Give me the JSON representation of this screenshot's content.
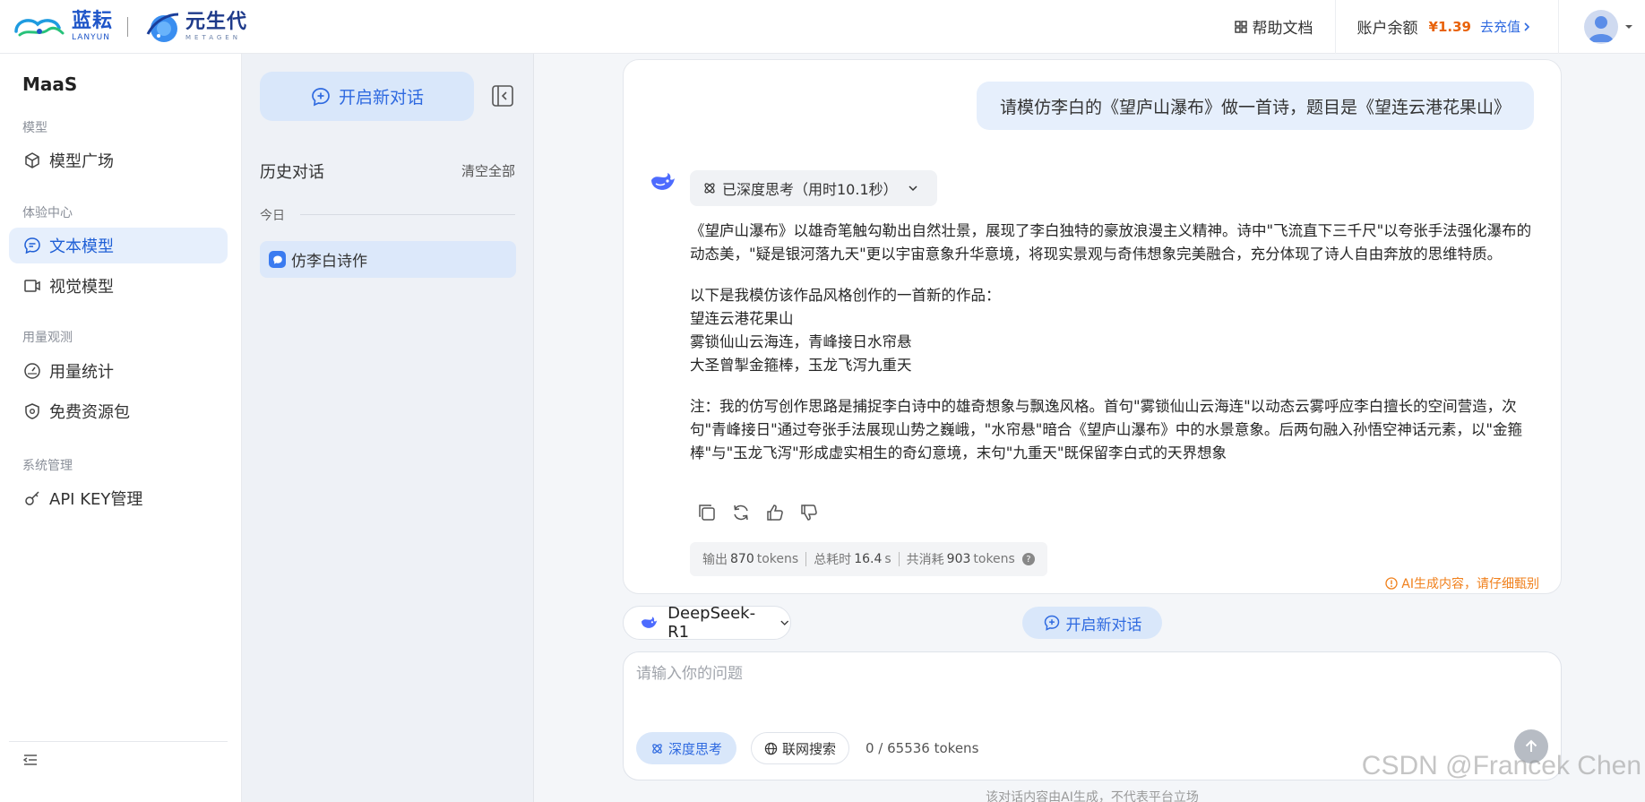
{
  "header": {
    "logo1_cn": "蓝耘",
    "logo1_en": "LANYUN",
    "logo2_cn": "元生代",
    "logo2_en": "METAGEN",
    "help_label": "帮助文档",
    "balance_label": "账户余额",
    "balance_amount": "¥1.39",
    "recharge_label": "去充值"
  },
  "sidebar": {
    "brand": "MaaS",
    "groups": [
      {
        "label": "模型",
        "items": [
          {
            "label": "模型广场",
            "icon": "cube-icon"
          }
        ]
      },
      {
        "label": "体验中心",
        "items": [
          {
            "label": "文本模型",
            "icon": "chat-icon",
            "active": true
          },
          {
            "label": "视觉模型",
            "icon": "video-icon"
          }
        ]
      },
      {
        "label": "用量观测",
        "items": [
          {
            "label": "用量统计",
            "icon": "gauge-icon"
          },
          {
            "label": "免费资源包",
            "icon": "shield-icon"
          }
        ]
      },
      {
        "label": "系统管理",
        "items": [
          {
            "label": "API KEY管理",
            "icon": "key-icon"
          }
        ]
      }
    ]
  },
  "history": {
    "new_chat_label": "开启新对话",
    "title": "历史对话",
    "clear_all": "清空全部",
    "today": "今日",
    "items": [
      "仿李白诗作"
    ]
  },
  "chat": {
    "user_message": "请模仿李白的《望庐山瀑布》做一首诗，题目是《望连云港花果山》",
    "think_label": "已深度思考（用时10.1秒）",
    "answer": {
      "p1": "《望庐山瀑布》以雄奇笔触勾勒出自然壮景，展现了李白独特的豪放浪漫主义精神。诗中\"飞流直下三千尺\"以夸张手法强化瀑布的动态美，\"疑是银河落九天\"更以宇宙意象升华意境，将现实景观与奇伟想象完美融合，充分体现了诗人自由奔放的思维特质。",
      "p2_intro": "以下是我模仿该作品风格创作的一首新的作品：",
      "poem_title": "望连云港花果山",
      "poem_line1": "雾锁仙山云海连，青峰接日水帘悬",
      "poem_line2": "大圣曾掣金箍棒，玉龙飞泻九重天",
      "note": "注：我的仿写创作思路是捕捉李白诗中的雄奇想象与飘逸风格。首句\"雾锁仙山云海连\"以动态云雾呼应李白擅长的空间营造，次句\"青峰接日\"通过夸张手法展现山势之巍峨，\"水帘悬\"暗合《望庐山瀑布》中的水景意象。后两句融入孙悟空神话元素，以\"金箍棒\"与\"玉龙飞泻\"形成虚实相生的奇幻意境，末句\"九重天\"既保留李白式的天界想象"
    },
    "stats": {
      "output_label": "输出",
      "output_value": "870",
      "output_unit": "tokens",
      "time_label": "总耗时",
      "time_value": "16.4",
      "time_unit": "s",
      "total_label": "共消耗",
      "total_value": "903",
      "total_unit": "tokens"
    },
    "ai_warning": "AI生成内容，请仔细甄别"
  },
  "composer": {
    "model": "DeepSeek-R1",
    "new_chat_label": "开启新对话",
    "placeholder": "请输入你的问题",
    "deep_think_label": "深度思考",
    "web_search_label": "联网搜索",
    "token_count": "0 / 65536 tokens"
  },
  "footer": {
    "disclaimer": "该对话内容由AI生成，不代表平台立场",
    "watermark": "CSDN @Francek Chen"
  },
  "colors": {
    "accent": "#2f6ae0",
    "active_bg": "#e6effc",
    "warning": "#f07f1a",
    "balance": "#e8620a"
  }
}
